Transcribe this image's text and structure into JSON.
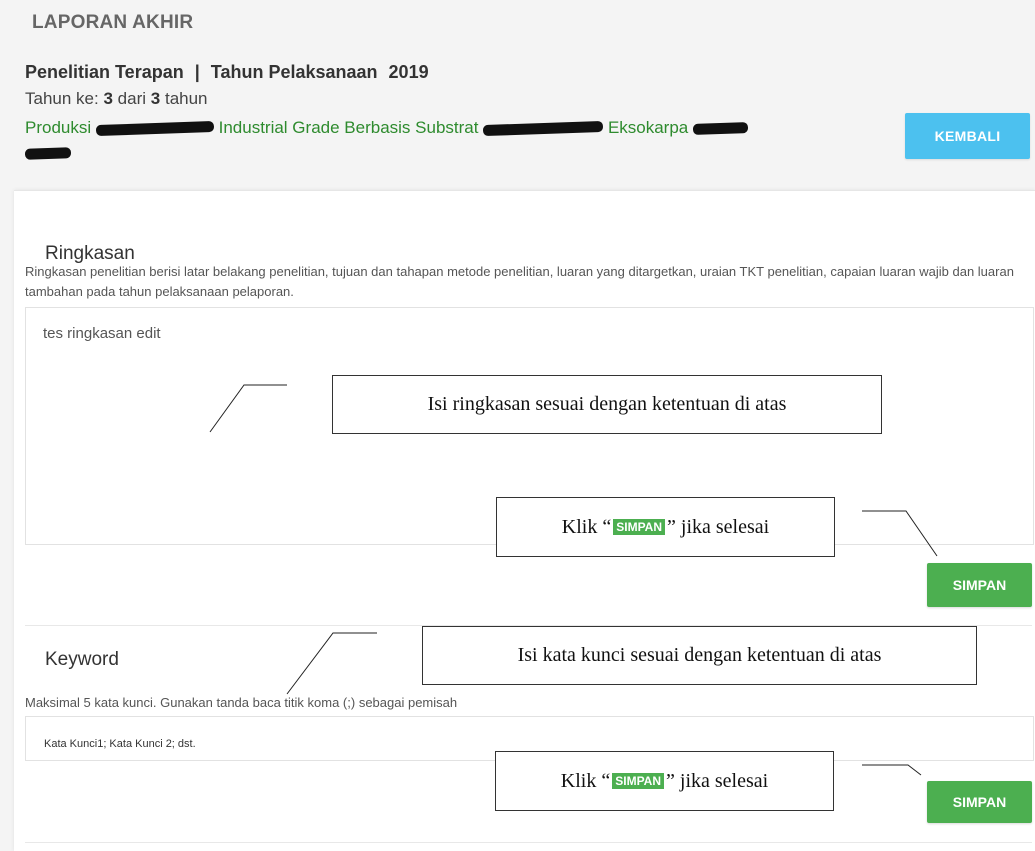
{
  "header": {
    "title": "LAPORAN AKHIR",
    "scheme": "Penelitian Terapan",
    "separator": "|",
    "year_label": "Tahun Pelaksanaan",
    "year_value": "2019",
    "progress_prefix": "Tahun ke:",
    "progress_current": "3",
    "progress_mid": "dari",
    "progress_total": "3",
    "progress_suffix": "tahun",
    "research_title_parts": [
      "Produksi",
      "Industrial Grade Berbasis Substrat",
      "Eksokarpa"
    ],
    "back_label": "KEMBALI"
  },
  "summary": {
    "title": "Ringkasan",
    "hint": "Ringkasan penelitian berisi latar belakang penelitian, tujuan dan tahapan metode penelitian, luaran yang ditargetkan, uraian TKT penelitian, capaian luaran wajib dan luaran tambahan pada tahun pelaksanaan pelaporan.",
    "value": "tes ringkasan edit",
    "save_label": "SIMPAN"
  },
  "keyword": {
    "title": "Keyword",
    "hint": "Maksimal 5 kata kunci. Gunakan tanda baca titik koma (;) sebagai pemisah",
    "placeholder": "Kata Kunci1; Kata Kunci 2; dst.",
    "save_label": "SIMPAN"
  },
  "annotations": {
    "summary_note": "Isi ringkasan sesuai dengan ketentuan di atas",
    "keyword_note": "Isi kata kunci sesuai dengan ketentuan di atas",
    "click_prefix": "Klik “",
    "click_badge": "SIMPAN",
    "click_suffix": "” jika selesai"
  },
  "colors": {
    "primary_blue": "#4cc1ef",
    "save_green": "#4caf50",
    "title_green": "#2e8b2e"
  }
}
